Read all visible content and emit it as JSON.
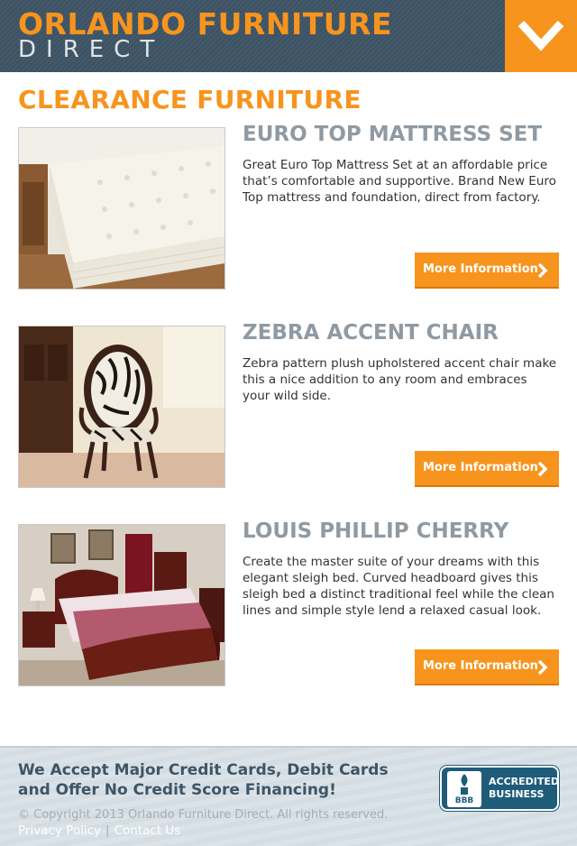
{
  "header": {
    "logo_line1": "ORLANDO FURNITURE",
    "logo_line2": "DIRECT",
    "menu_icon": "chevron-down-icon"
  },
  "page_title": "CLEARANCE FURNITURE",
  "products": [
    {
      "name": "EURO TOP MATTRESS SET",
      "description": "Great Euro Top Mattress Set at an affordable price that’s comfortable and supportive. Brand New Euro Top mattress and foundation, direct from factory.",
      "button_label": "More Information",
      "image": "mattress-image"
    },
    {
      "name": "ZEBRA ACCENT CHAIR",
      "description": "Zebra pattern plush upholstered accent chair make this a nice addition to any room and embraces your wild side.",
      "button_label": "More Information",
      "image": "chair-image"
    },
    {
      "name": "LOUIS PHILLIP CHERRY",
      "description": "Create the master suite of your dreams with this elegant sleigh bed. Curved headboard gives this sleigh bed a distinct traditional feel while the clean lines and simple style lend a relaxed casual look.",
      "button_label": "More Information",
      "image": "bed-image"
    }
  ],
  "footer": {
    "headline": "We Accept Major Credit Cards, Debit Cards and Offer No Credit Score Financing!",
    "copyright": "© Copyright 2013 Orlando Furniture Direct. All rights reserved.",
    "links": [
      "Privacy Policy",
      "Contact Us"
    ],
    "link_separator": "|",
    "bbb_seal": "BBB",
    "bbb_line1": "ACCREDITED",
    "bbb_line2": "BUSINESS"
  },
  "colors": {
    "accent": "#f7941d",
    "header_bg": "#3e5566",
    "product_title": "#8f9aa3",
    "footer_bg": "#d4dde3"
  }
}
